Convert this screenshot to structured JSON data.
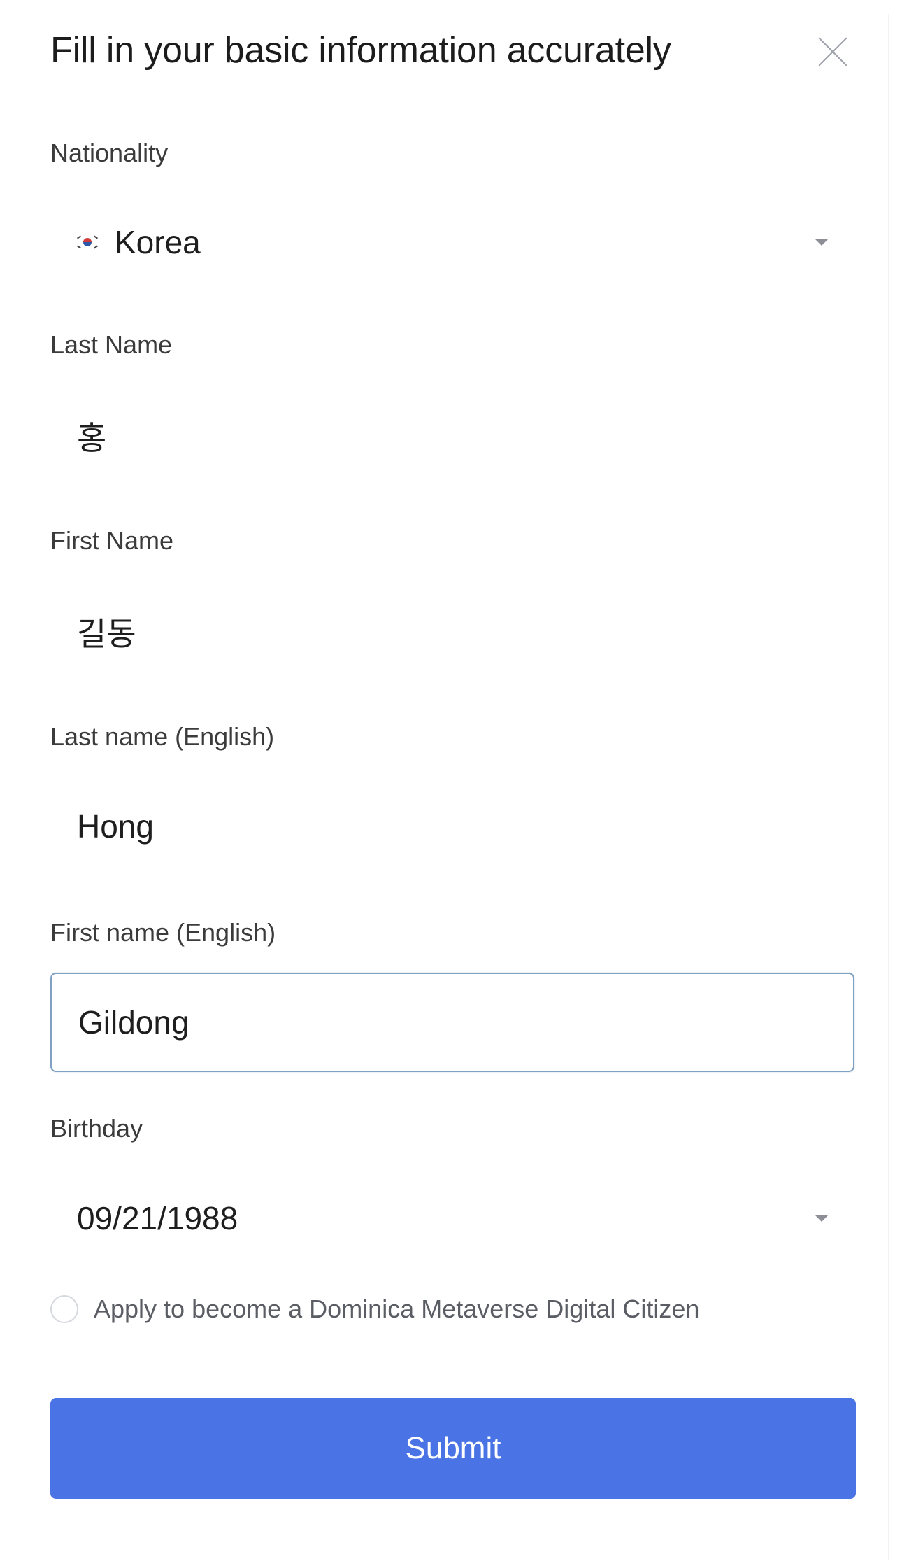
{
  "dialog": {
    "title": "Fill in your basic information accurately",
    "close_icon": "close-icon"
  },
  "fields": {
    "nationality": {
      "label": "Nationality",
      "value": "Korea",
      "flag_icon": "south-korea-flag-icon",
      "caret_icon": "chevron-down-icon"
    },
    "last_name": {
      "label": "Last Name",
      "value": "홍"
    },
    "first_name": {
      "label": "First Name",
      "value": "길동"
    },
    "last_name_en": {
      "label": "Last name (English)",
      "value": "Hong"
    },
    "first_name_en": {
      "label": "First name (English)",
      "value": "Gildong"
    },
    "birthday": {
      "label": "Birthday",
      "value": "09/21/1988",
      "caret_icon": "chevron-down-icon"
    }
  },
  "citizen_option": {
    "label": "Apply to become a Dominica Metaverse Digital Citizen",
    "checked": false
  },
  "submit": {
    "label": "Submit"
  },
  "colors": {
    "primary_button": "#4a74e6",
    "focus_border": "#7fa2c4",
    "label_text": "#3b3b3b"
  }
}
